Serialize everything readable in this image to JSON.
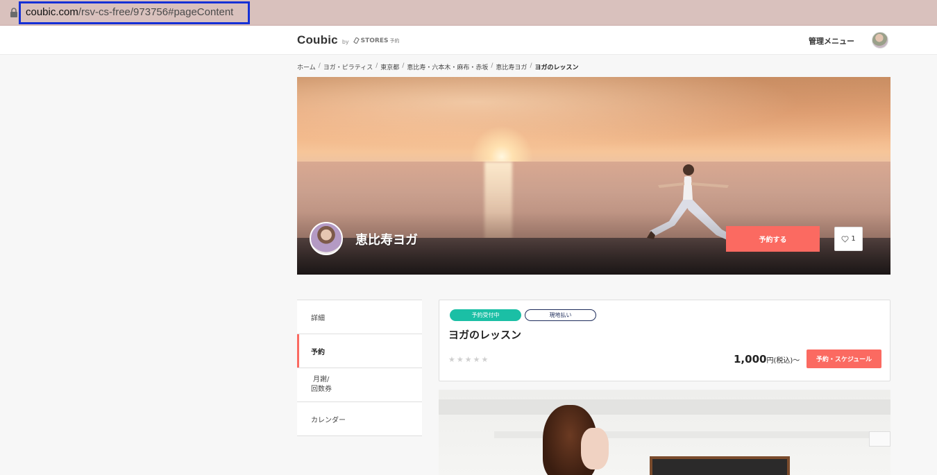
{
  "browser": {
    "url_domain": "coubic.com",
    "url_path": "/rsv-cs-free/973756#pageContent"
  },
  "header": {
    "logo": "Coubic",
    "logo_by": "by",
    "logo_stores": "STORES",
    "logo_stores_sub": "予約",
    "admin_menu": "管理メニュー"
  },
  "breadcrumb": [
    "ホーム",
    "ヨガ・ピラティス",
    "東京都",
    "恵比寿・六本木・麻布・赤坂",
    "恵比寿ヨガ",
    "ヨガのレッスン"
  ],
  "breadcrumb_sep": "/",
  "hero": {
    "store_name": "恵比寿ヨガ",
    "reserve_label": "予約する",
    "favorite_count": "1"
  },
  "sidenav": {
    "details": "詳細",
    "reservation": "予約",
    "monthly_line1": "月謝/",
    "monthly_line2": "回数券",
    "calendar": "カレンダー"
  },
  "lesson": {
    "status_badge": "予約受付中",
    "payment_badge": "現地払い",
    "title": "ヨガのレッスン",
    "rating_stars": 0,
    "price": "1,000",
    "price_unit": "円(税込)〜",
    "schedule_button": "予約・スケジュール"
  },
  "colors": {
    "accent": "#fb6a61",
    "badge_green": "#1bbfa5",
    "badge_navy": "#1c2b5a",
    "url_highlight": "#1530d6"
  }
}
